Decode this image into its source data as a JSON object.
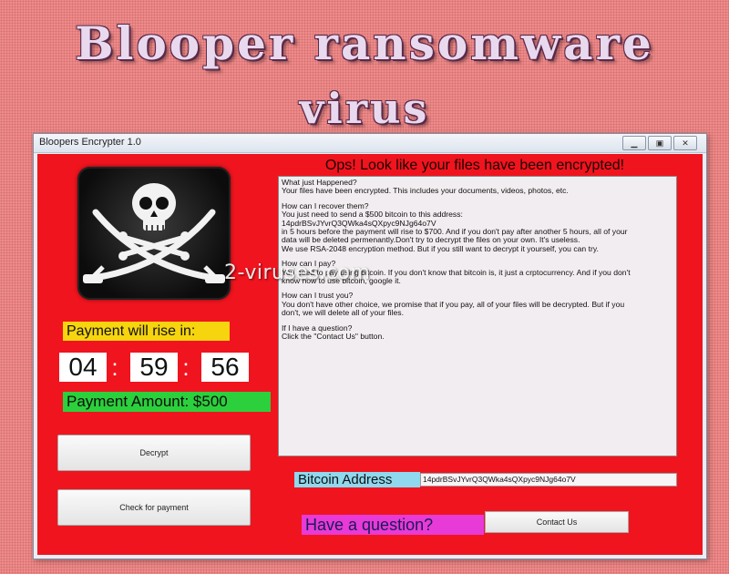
{
  "banner": {
    "line1": "Blooper ransomware",
    "line2": "virus"
  },
  "window": {
    "title": "Bloopers Encrypter 1.0",
    "controls": [
      "minimize",
      "maximize",
      "close"
    ]
  },
  "left_panel": {
    "payment_rise_label": "Payment will rise in:",
    "timer": {
      "hours": "04",
      "minutes": "59",
      "seconds": "56",
      "separator": ":"
    },
    "payment_amount": "Payment Amount: $500",
    "decrypt_button": "Decrypt",
    "check_payment_button": "Check for payment"
  },
  "message": {
    "heading": "Ops! Look like your files have been encrypted!",
    "paragraphs": [
      [
        "What just Happened?",
        "Your files have been encrypted. This includes your documents, videos, photos, etc."
      ],
      [
        "How can I recover them?",
        "You just need to send a $500 bitcoin to this address:",
        "14pdrBSvJYvrQ3QWka4sQXpyc9NJg64o7V",
        "in 5 hours before the payment will rise to $700. And if you don't pay after another 5 hours, all of your",
        "data will be deleted permenantly.Don't try to decrypt the files on your own. It's useless.",
        "We use RSA-2048 encryption method. But if you still want to decrypt it yourself, you can try."
      ],
      [
        "How can I pay?",
        "You need to pay using bitcoin. If you don't know that bitcoin is, it just a crptocurrency. And if you don't",
        "know how to use bitcoin, google it."
      ],
      [
        "How can I trust you?",
        "You don't have other choice, we promise that if you pay, all of your files will be decrypted. But if you",
        "don't, we will delete all of your files."
      ],
      [
        "If I have a question?",
        "Click the \"Contact Us\" button."
      ]
    ]
  },
  "watermark": "2-viruses.com",
  "bitcoin": {
    "label": "Bitcoin Address",
    "value": "14pdrBSvJYvrQ3QWka4sQXpyc9NJg64o7V"
  },
  "question": {
    "label": "Have a question?",
    "contact_button": "Contact Us"
  },
  "colors": {
    "background": "#f08a8a",
    "panel_red": "#f0141e",
    "yellow": "#f6d40e",
    "green": "#2bd03c",
    "cyan": "#8fd8ee",
    "magenta": "#e73ad6"
  }
}
